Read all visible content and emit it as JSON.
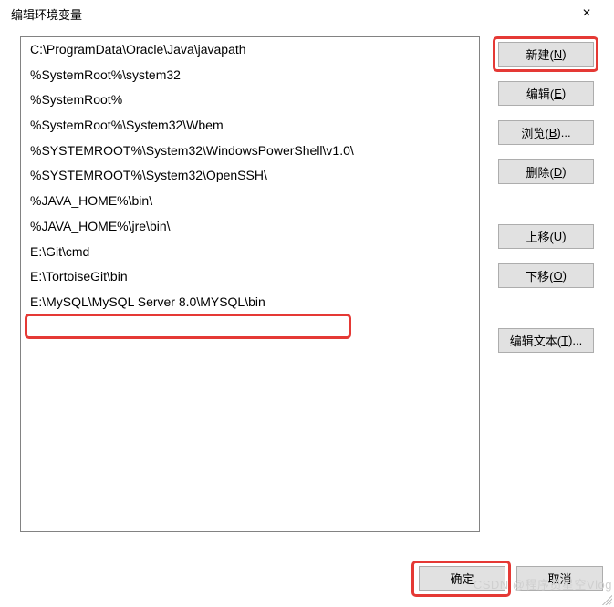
{
  "title": "编辑环境变量",
  "close_glyph": "×",
  "list": {
    "items": [
      "C:\\ProgramData\\Oracle\\Java\\javapath",
      "%SystemRoot%\\system32",
      "%SystemRoot%",
      "%SystemRoot%\\System32\\Wbem",
      "%SYSTEMROOT%\\System32\\WindowsPowerShell\\v1.0\\",
      "%SYSTEMROOT%\\System32\\OpenSSH\\",
      "%JAVA_HOME%\\bin\\",
      "%JAVA_HOME%\\jre\\bin\\",
      "E:\\Git\\cmd",
      "E:\\TortoiseGit\\bin",
      "E:\\MySQL\\MySQL Server 8.0\\MYSQL\\bin"
    ],
    "highlighted_index": 10
  },
  "buttons": {
    "new_": {
      "text": "新建(",
      "key": "N",
      "suffix": ")"
    },
    "edit": {
      "text": "编辑(",
      "key": "E",
      "suffix": ")"
    },
    "browse": {
      "text": "浏览(",
      "key": "B",
      "suffix": ")..."
    },
    "delete": {
      "text": "删除(",
      "key": "D",
      "suffix": ")"
    },
    "up": {
      "text": "上移(",
      "key": "U",
      "suffix": ")"
    },
    "down": {
      "text": "下移(",
      "key": "O",
      "suffix": ")"
    },
    "edit_text": {
      "text": "编辑文本(",
      "key": "T",
      "suffix": ")..."
    },
    "ok": {
      "label": "确定"
    },
    "cancel": {
      "label": "取消"
    }
  },
  "watermark": "CSDN @程序员星空Vlog",
  "colors": {
    "highlight": "#e53935"
  }
}
